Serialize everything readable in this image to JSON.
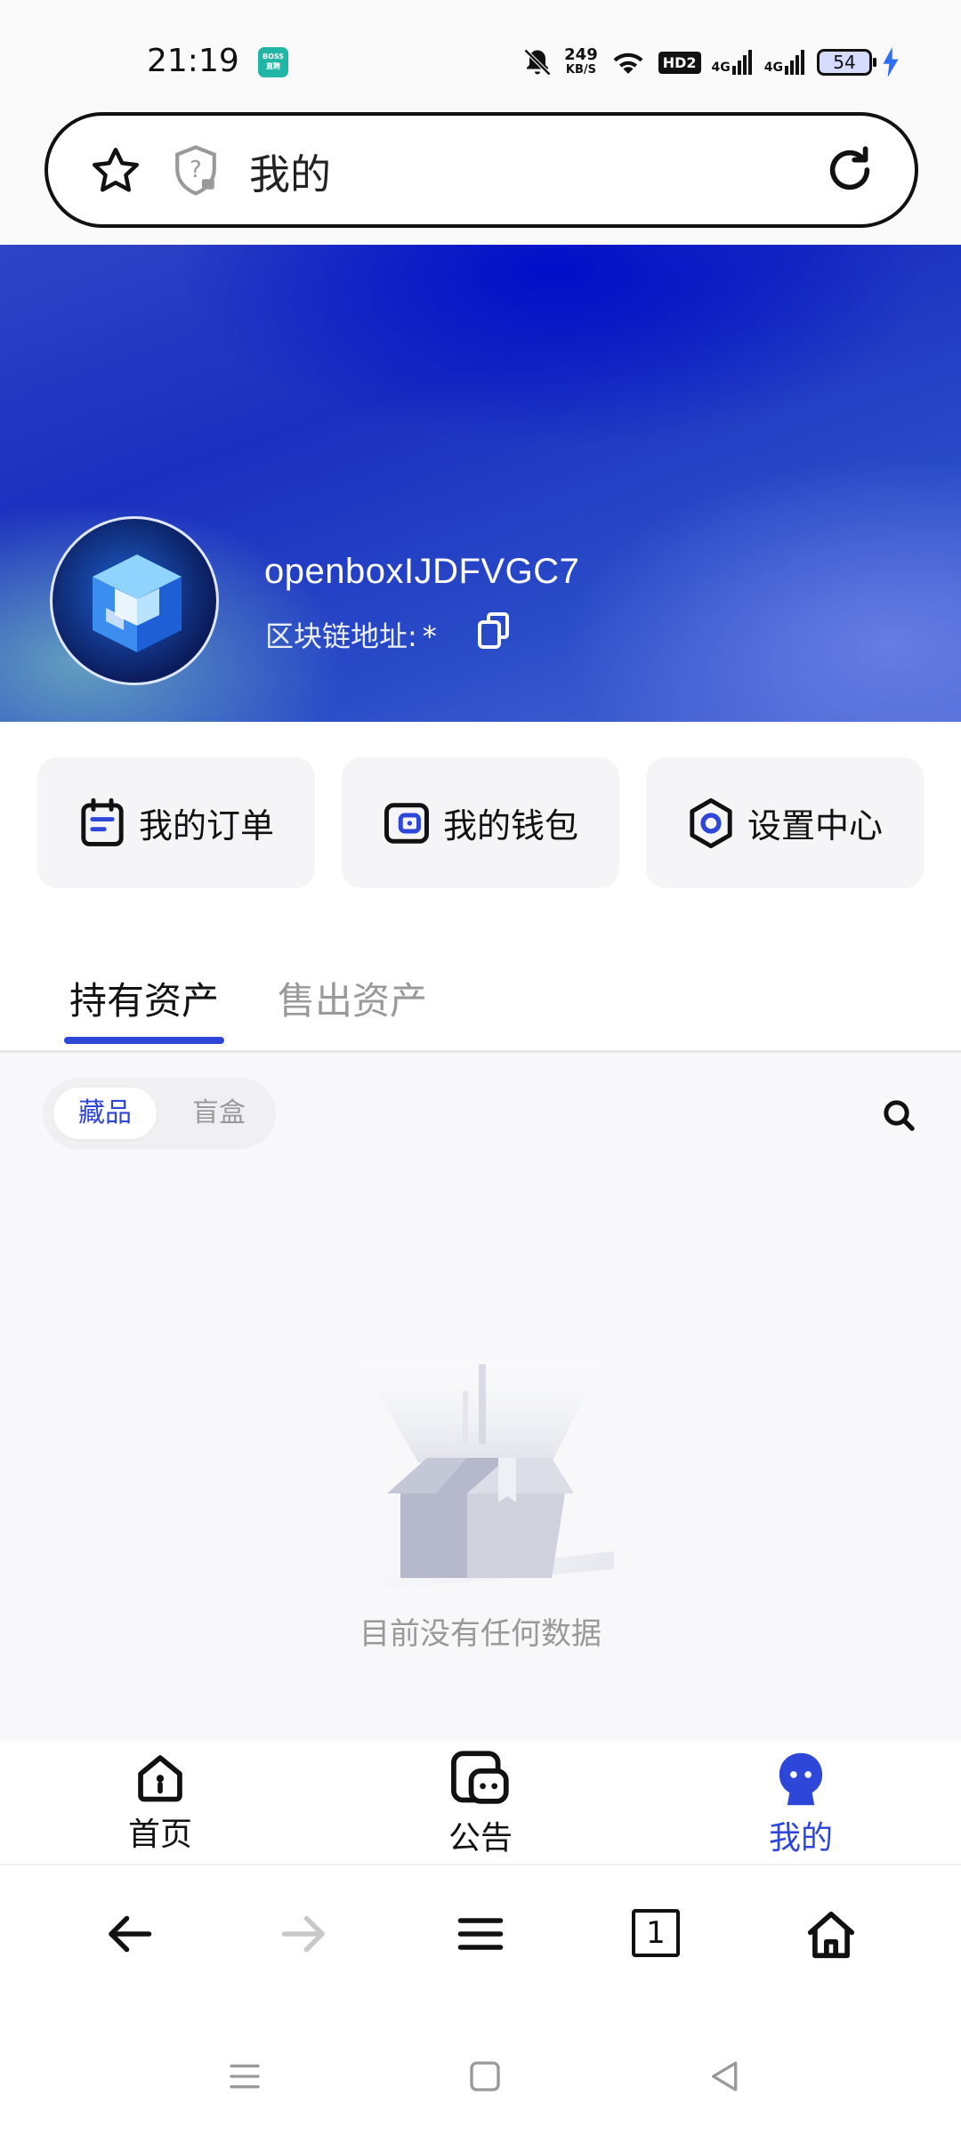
{
  "status_bar": {
    "time": "21:19",
    "app_badge": "BOSS直聘",
    "net_speed_value": "249",
    "net_speed_unit": "KB/S",
    "hd_label": "HD2",
    "signal1_label": "4G",
    "signal2_label": "4G",
    "battery": "54"
  },
  "address_bar": {
    "title": "我的"
  },
  "profile": {
    "username": "openboxIJDFVGC7",
    "chain_label": "区块链地址:",
    "chain_value": "*"
  },
  "quick_actions": [
    {
      "label": "我的订单",
      "icon": "calendar-icon"
    },
    {
      "label": "我的钱包",
      "icon": "wallet-icon"
    },
    {
      "label": "设置中心",
      "icon": "settings-hex-icon"
    }
  ],
  "tabs": {
    "active": "持有资产",
    "inactive": "售出资产"
  },
  "segment": {
    "selected": "藏品",
    "other": "盲盒"
  },
  "empty_state": {
    "text": "目前没有任何数据"
  },
  "app_nav": [
    {
      "label": "首页",
      "icon": "home-icon",
      "active": false
    },
    {
      "label": "公告",
      "icon": "notice-icon",
      "active": false
    },
    {
      "label": "我的",
      "icon": "profile-icon",
      "active": true
    }
  ],
  "browser_toolbar": {
    "tab_count": "1"
  },
  "colors": {
    "accent": "#2f47d9",
    "inactive_text": "#999999",
    "banner_blue": "#1b2fbf"
  }
}
